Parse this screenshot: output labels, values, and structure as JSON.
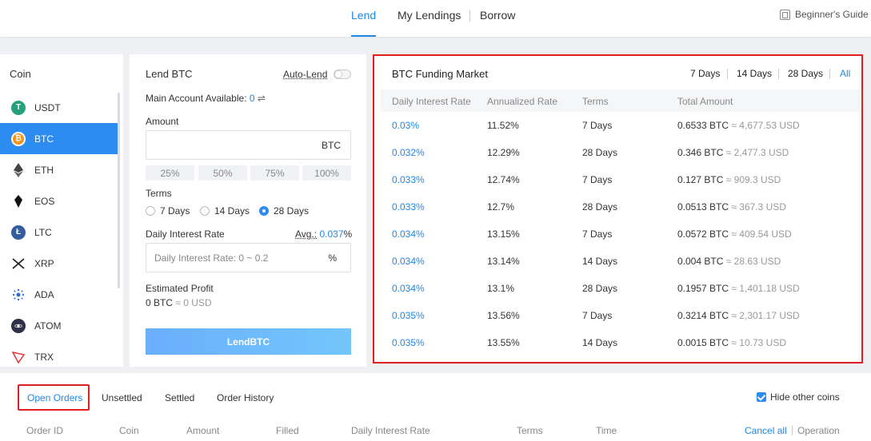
{
  "nav": {
    "tabs": [
      "Lend",
      "My Lendings",
      "Borrow"
    ],
    "active": "Lend",
    "guide": "Beginner's Guide"
  },
  "coins": {
    "header": "Coin",
    "items": [
      "USDT",
      "BTC",
      "ETH",
      "EOS",
      "LTC",
      "XRP",
      "ADA",
      "ATOM",
      "TRX"
    ],
    "selected": "BTC"
  },
  "lend": {
    "title": "Lend BTC",
    "auto_lend": "Auto-Lend",
    "main_account_label": "Main Account Available:",
    "main_account_value": "0",
    "amount_label": "Amount",
    "amount_unit": "BTC",
    "percents": [
      "25%",
      "50%",
      "75%",
      "100%"
    ],
    "terms_label": "Terms",
    "terms": [
      "7 Days",
      "14 Days",
      "28 Days"
    ],
    "selected_term": "28 Days",
    "rate_label": "Daily Interest Rate",
    "avg_label": "Avg.:",
    "avg_value": "0.037",
    "avg_unit": "%",
    "rate_placeholder": "Daily Interest Rate: 0 ~ 0.2",
    "rate_unit": "%",
    "profit_label": "Estimated Profit",
    "profit_btc": "0 BTC",
    "profit_usd": "≈ 0 USD",
    "button": "LendBTC"
  },
  "market": {
    "title": "BTC Funding Market",
    "filters": [
      "7 Days",
      "14 Days",
      "28 Days",
      "All"
    ],
    "columns": [
      "Daily Interest Rate",
      "Annualized Rate",
      "Terms",
      "Total Amount"
    ],
    "rows": [
      {
        "rate": "0.03%",
        "annual": "11.52%",
        "terms": "7 Days",
        "btc": "0.6533 BTC",
        "usd": "≈ 4,677.53 USD"
      },
      {
        "rate": "0.032%",
        "annual": "12.29%",
        "terms": "28 Days",
        "btc": "0.346 BTC",
        "usd": "≈ 2,477.3 USD"
      },
      {
        "rate": "0.033%",
        "annual": "12.74%",
        "terms": "7 Days",
        "btc": "0.127 BTC",
        "usd": "≈ 909.3 USD"
      },
      {
        "rate": "0.033%",
        "annual": "12.7%",
        "terms": "28 Days",
        "btc": "0.0513 BTC",
        "usd": "≈ 367.3 USD"
      },
      {
        "rate": "0.034%",
        "annual": "13.15%",
        "terms": "7 Days",
        "btc": "0.0572 BTC",
        "usd": "≈ 409.54 USD"
      },
      {
        "rate": "0.034%",
        "annual": "13.14%",
        "terms": "14 Days",
        "btc": "0.004 BTC",
        "usd": "≈ 28.63 USD"
      },
      {
        "rate": "0.034%",
        "annual": "13.1%",
        "terms": "28 Days",
        "btc": "0.1957 BTC",
        "usd": "≈ 1,401.18 USD"
      },
      {
        "rate": "0.035%",
        "annual": "13.56%",
        "terms": "7 Days",
        "btc": "0.3214 BTC",
        "usd": "≈ 2,301.17 USD"
      },
      {
        "rate": "0.035%",
        "annual": "13.55%",
        "terms": "14 Days",
        "btc": "0.0015 BTC",
        "usd": "≈ 10.73 USD"
      }
    ]
  },
  "orders": {
    "tabs": [
      "Open Orders",
      "Unsettled",
      "Settled",
      "Order History"
    ],
    "active": "Open Orders",
    "hide_other": "Hide other coins",
    "hide_checked": true,
    "columns": [
      "Order ID",
      "Coin",
      "Amount",
      "Filled",
      "Daily Interest Rate",
      "Terms",
      "Time"
    ],
    "cancel_all": "Cancel all",
    "operation": "Operation"
  },
  "colors": {
    "accent": "#1e88e5",
    "highlight_border": "#e02020",
    "usdt": "#26a17b",
    "btc": "#f7931a"
  }
}
